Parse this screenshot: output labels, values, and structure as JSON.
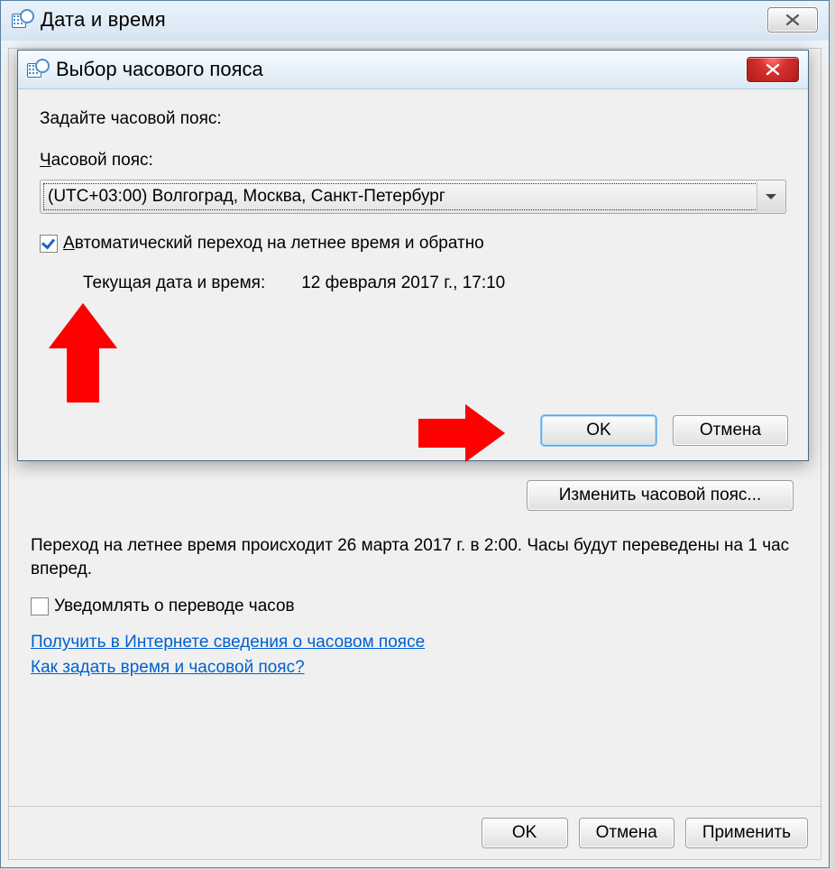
{
  "outer": {
    "title": "Дата и время",
    "change_tz_btn": "Изменить часовой пояс...",
    "dst_info": "Переход на летнее время происходит 26 марта 2017 г. в 2:00. Часы будут переведены на 1 час вперед.",
    "notify_label": "Уведомлять о переводе часов",
    "notify_checked": false,
    "link_online": "Получить в Интернете сведения о часовом поясе",
    "link_howto": "Как задать время и часовой пояс?",
    "ok": "OK",
    "cancel": "Отмена",
    "apply": "Применить"
  },
  "modal": {
    "title": "Выбор часового пояса",
    "prompt": "Задайте часовой пояс:",
    "combo_label_prefix": "Ч",
    "combo_label_rest": "асовой пояс:",
    "combo_value": "(UTC+03:00) Волгоград, Москва, Санкт-Петербург",
    "auto_dst_prefix": "А",
    "auto_dst_rest": "втоматический переход на летнее время и обратно",
    "auto_dst_checked": true,
    "current_label": "Текущая дата и время:",
    "current_value": "12 февраля 2017 г., 17:10",
    "ok": "OK",
    "cancel": "Отмена"
  }
}
